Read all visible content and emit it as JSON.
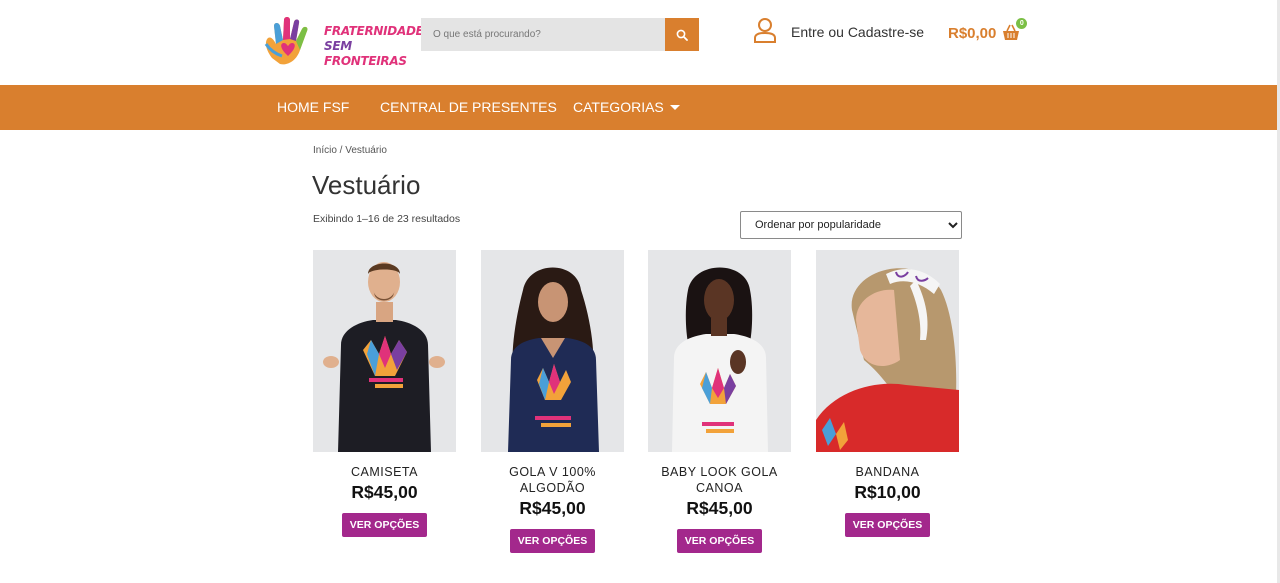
{
  "header": {
    "logo_line1": "FRATERNIDADE",
    "logo_line2_a": "SEM",
    "logo_line2_b": "FRONTEIRAS",
    "search": {
      "placeholder": "O que está procurando?"
    },
    "account_label": "Entre ou Cadastre-se",
    "cart_total": "R$0,00",
    "cart_count": "0"
  },
  "nav": {
    "items": [
      "HOME FSF",
      "CENTRAL DE PRESENTES",
      "CATEGORIAS"
    ]
  },
  "breadcrumb": {
    "home": "Início",
    "separator": " / ",
    "current": "Vestuário"
  },
  "page": {
    "title": "Vestuário",
    "result_count": "Exibindo 1–16 de 23 resultados",
    "sort_selected": "Ordenar por popularidade"
  },
  "products": [
    {
      "name": "CAMISETA",
      "price": "R$45,00",
      "button": "VER OPÇÕES"
    },
    {
      "name": "GOLA V 100% ALGODÃO",
      "price": "R$45,00",
      "button": "VER OPÇÕES"
    },
    {
      "name": "BABY LOOK GOLA CANOA",
      "price": "R$45,00",
      "button": "VER OPÇÕES"
    },
    {
      "name": "BANDANA",
      "price": "R$10,00",
      "button": "VER OPÇÕES"
    }
  ],
  "colors": {
    "accent_orange": "#d97f2e",
    "button_magenta": "#a3288c",
    "badge_green": "#7bbf45"
  }
}
